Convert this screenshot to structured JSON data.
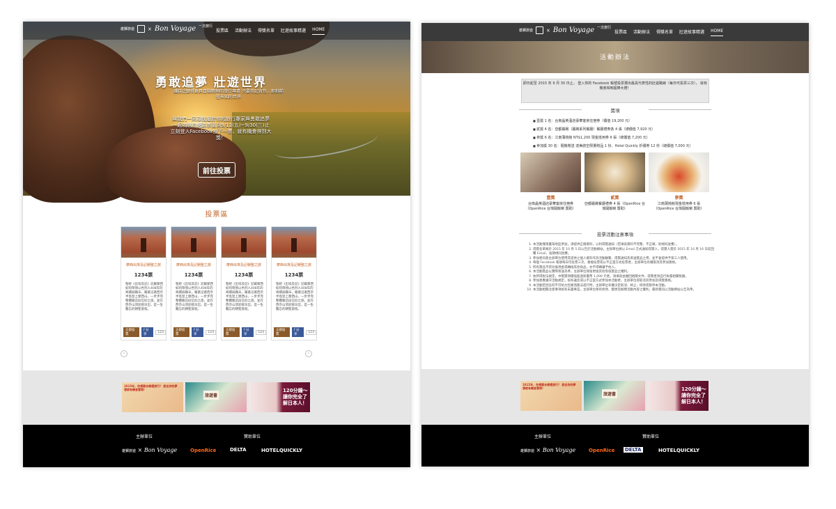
{
  "nav": {
    "logo_tag": "雄獅旅遊",
    "logo_brand": "Bon Voyage",
    "logo_sub": "一次旅行",
    "items": [
      "投票區",
      "活動辦法",
      "得獎名單",
      "壯遊故事精選",
      "HOME"
    ]
  },
  "left": {
    "hero_title": "勇敢追夢 壯遊世界",
    "hero_sub": "讓自己變得更具冒險精神的旅行專書 只要持起背包，即刻前往未知的世界",
    "hero_cta": "與我們一同尋找屬於你的旅行專家與勇敢追夢 一起閱世界網路票選自9/11(五)~9/30(三)止 立刻登入Facebook投下一票，就有機會得到大獎！",
    "vote_button": "前往投票",
    "section_title": "投票區",
    "cards": [
      {
        "title": "摩西出埃及記朝聖之旅",
        "votes": "1234票",
        "desc": "聖經《出埃及記》記載摩西如何帶領以色列人408年的奇蹟與艱辛，藉著沿著西奈半島登上摩西山，一步步完整體驗這段信仰之旅，並在西奈山頂迎接日出，是一生難忘的朝聖旅程。",
        "vote": "立即投票",
        "share": "分享",
        "count": "123"
      },
      {
        "title": "摩西出埃及記朝聖之旅",
        "votes": "1234票",
        "desc": "聖經《出埃及記》記載摩西如何帶領以色列人408年的奇蹟與艱辛，藉著沿著西奈半島登上摩西山，一步步完整體驗這段信仰之旅，並在西奈山頂迎接日出，是一生難忘的朝聖旅程。",
        "vote": "立即投票",
        "share": "分享",
        "count": "123"
      },
      {
        "title": "摩西出埃及記朝聖之旅",
        "votes": "1234票",
        "desc": "聖經《出埃及記》記載摩西如何帶領以色列人408年的奇蹟與艱辛，藉著沿著西奈半島登上摩西山，一步步完整體驗這段信仰之旅，並在西奈山頂迎接日出，是一生難忘的朝聖旅程。",
        "vote": "立即投票",
        "share": "分享",
        "count": "123"
      },
      {
        "title": "摩西出埃及記朝聖之旅",
        "votes": "1234票",
        "desc": "聖經《出埃及記》記載摩西如何帶領以色列人408年的奇蹟與艱辛，藉著沿著西奈半島登上摩西山，一步步完整體驗這段信仰之旅，並在西奈山頂迎接日出，是一生難忘的朝聖旅程。",
        "vote": "立即投票",
        "share": "分享",
        "count": "123"
      }
    ]
  },
  "banners": {
    "b1": "2015年，你想要去哪裡旅行？ 說出你的夢想就有機會實現！",
    "b2": "旅遊書",
    "b3": "120分鐘～讓你完全了解日本人！"
  },
  "footer": {
    "organizer_label": "主辦單位",
    "sponsor_label": "贊助單位",
    "sponsors": [
      "OpenRice",
      "DELTA",
      "HOTELQUICKLY"
    ]
  },
  "right": {
    "page_title": "活動辦法",
    "notice": "即日起至 2015 年 9 月 30 日止， 登入你的 Facebook 帳號投票選出最具代表性的壯遊路線（每日可投票三次）， 就有機會得到超棒大禮！",
    "prizes_title": "獎項",
    "prizes": [
      "壹獎 1 名：台南晶英酒店豪華客房住宿券（價值 19,200 元）",
      "貳獎 4 名：亞都麗緻（麗緻系列餐廳）餐廳禮券各 4 張（總價值 7,920 元）",
      "參獎 6 名：江南蒲燒館 NT$1,200 現金抵用券 6 張（總價值 7,200 元）",
      "參加獎 30 名：隨機贈送 達美航空限量贈品 1 份、Hotel Quickly 折價券 12 份（總價值 7,000 元）"
    ],
    "prize_labels": [
      {
        "rank": "壹獎",
        "desc": "台南晶英酒店豪華客房住宿券（OpenRice 台灣開飯喇 贊助）"
      },
      {
        "rank": "貳獎",
        "desc": "亞都麗緻餐廳禮券 4 張（OpenRice 台灣開飯喇 贊助）"
      },
      {
        "rank": "參獎",
        "desc": "江南蒲燒館現金抵用券 6 張（OpenRice 台灣開飯喇 贊助）"
      }
    ],
    "rules_title": "投票活動注意事項",
    "rules": [
      "本活動僅限臺灣地區參加，須提供正確資料，以利得獎通知（若填寫資料不完整、不正確，則視同放棄）。",
      "得獎名單將於 2015 年 10 月 5 日公告於活動網站，主辦單位將以 Email 方式通知得獎人，得獎人需於 2015 年 10 月 16 日前回覆 Email，逾期視同放棄。",
      "參加者同意主辦單位使用其提供之個人資料作為活動聯繫、得獎通知及寄送獎品之用，並不會提供予第三人使用。",
      "每個 Facebook 帳號每日可投票三次，重複投票或以不正當方式投票者，主辦單位有權取消其參加資格。",
      "所有獎品不得兌換現金或轉換其他商品，亦不得轉讓予他人。",
      "本活動獎品以實際寄送為準，主辦單位保留更換其他等值獎品之權利。",
      "依所得稅法規定，中獎獎項價值超過新臺幣 1,000 元者，須填寫並繳回相關文件，得獎者須自行負擔相關稅額。",
      "參加者應遵守活動規定，如有違反或以不正當方式參加本活動者，主辦單位得取消其參加及得獎資格。",
      "本活動若因任何不可抗力因素而無法進行時，主辦單位有權決定取消、終止、修改或暫停本活動。",
      "本活動相關注意事項如有未盡事宜，主辦單位保有修改、變更及解釋活動內容之權利，最新資訊以活動網站公告為準。"
    ]
  }
}
